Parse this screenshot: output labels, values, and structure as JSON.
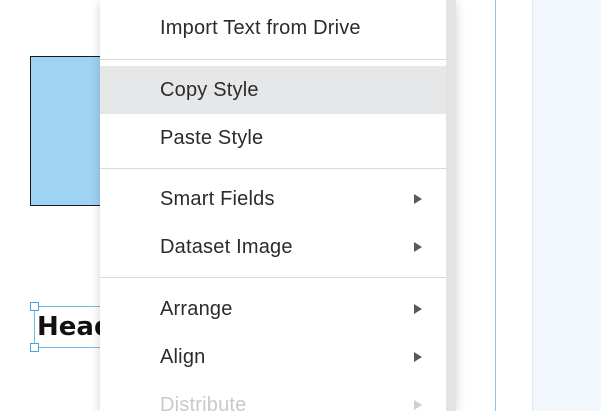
{
  "canvas": {
    "heading_text": "Head"
  },
  "context_menu": {
    "items": [
      {
        "label": "Import Text from Drive",
        "has_submenu": false,
        "state": "normal"
      },
      {
        "label": "Copy Style",
        "has_submenu": false,
        "state": "hovered"
      },
      {
        "label": "Paste Style",
        "has_submenu": false,
        "state": "normal"
      },
      {
        "label": "Smart Fields",
        "has_submenu": true,
        "state": "normal"
      },
      {
        "label": "Dataset Image",
        "has_submenu": true,
        "state": "normal"
      },
      {
        "label": "Arrange",
        "has_submenu": true,
        "state": "normal"
      },
      {
        "label": "Align",
        "has_submenu": true,
        "state": "normal"
      },
      {
        "label": "Distribute",
        "has_submenu": true,
        "state": "disabled"
      }
    ]
  },
  "colors": {
    "shape_fill": "#9fd3f3",
    "selection_handle": "#4aa3df",
    "menu_hover": "#e6e7e9",
    "right_panel_bg": "#f1f7fd"
  },
  "icons": {
    "submenu": "chevron-right-icon"
  }
}
